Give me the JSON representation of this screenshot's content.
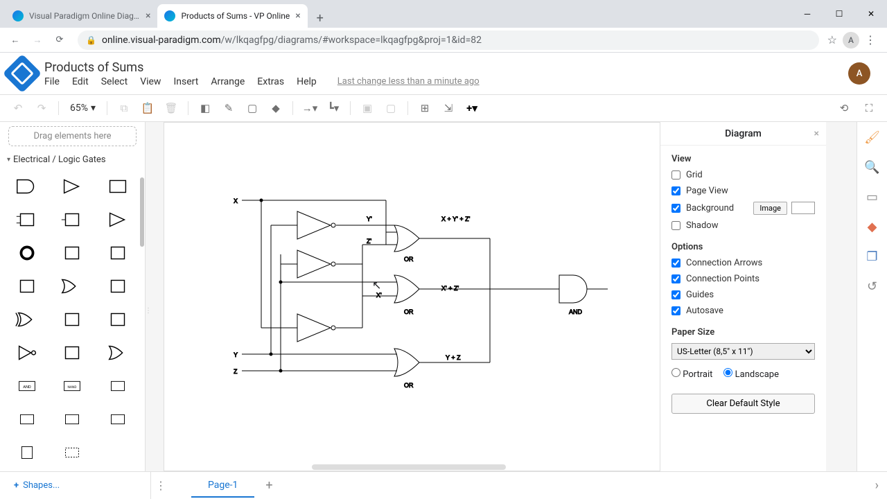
{
  "browser": {
    "tabs": [
      {
        "title": "Visual Paradigm Online Diagram",
        "active": false
      },
      {
        "title": "Products of Sums - VP Online",
        "active": true
      }
    ],
    "url_domain": "online.visual-paradigm.com",
    "url_path": "/w/lkqagfpg/diagrams/#workspace=lkqagfpg&proj=1&id=82",
    "profile_initial": "A"
  },
  "app": {
    "doc_title": "Products of Sums",
    "menus": [
      "File",
      "Edit",
      "Select",
      "View",
      "Insert",
      "Arrange",
      "Extras",
      "Help"
    ],
    "last_change": "Last change less than a minute ago",
    "avatar_initial": "A"
  },
  "toolbar": {
    "zoom": "65%"
  },
  "shapes": {
    "drag_hint": "Drag elements here",
    "category": "Electrical / Logic Gates",
    "more": "Shapes..."
  },
  "diagram": {
    "inputs": [
      "X",
      "Y",
      "Z"
    ],
    "node_labels": {
      "y_not": "Y'",
      "z_not": "Z'",
      "x_not": "X'"
    },
    "gate_labels": {
      "or1": "OR",
      "or2": "OR",
      "or3": "OR",
      "and": "AND"
    },
    "outputs": {
      "e1": "X + Y' + Z'",
      "e2": "X' + Z'",
      "e3": "Y + Z"
    }
  },
  "props": {
    "title": "Diagram",
    "sections": {
      "view": "View",
      "options": "Options",
      "paper": "Paper Size"
    },
    "view": {
      "grid": "Grid",
      "pageview": "Page View",
      "background": "Background",
      "shadow": "Shadow",
      "image_btn": "Image"
    },
    "options": {
      "arrows": "Connection Arrows",
      "points": "Connection Points",
      "guides": "Guides",
      "autosave": "Autosave"
    },
    "paper": {
      "size": "US-Letter (8,5\" x 11\")",
      "portrait": "Portrait",
      "landscape": "Landscape"
    },
    "clear": "Clear Default Style"
  },
  "footer": {
    "page": "Page-1"
  }
}
